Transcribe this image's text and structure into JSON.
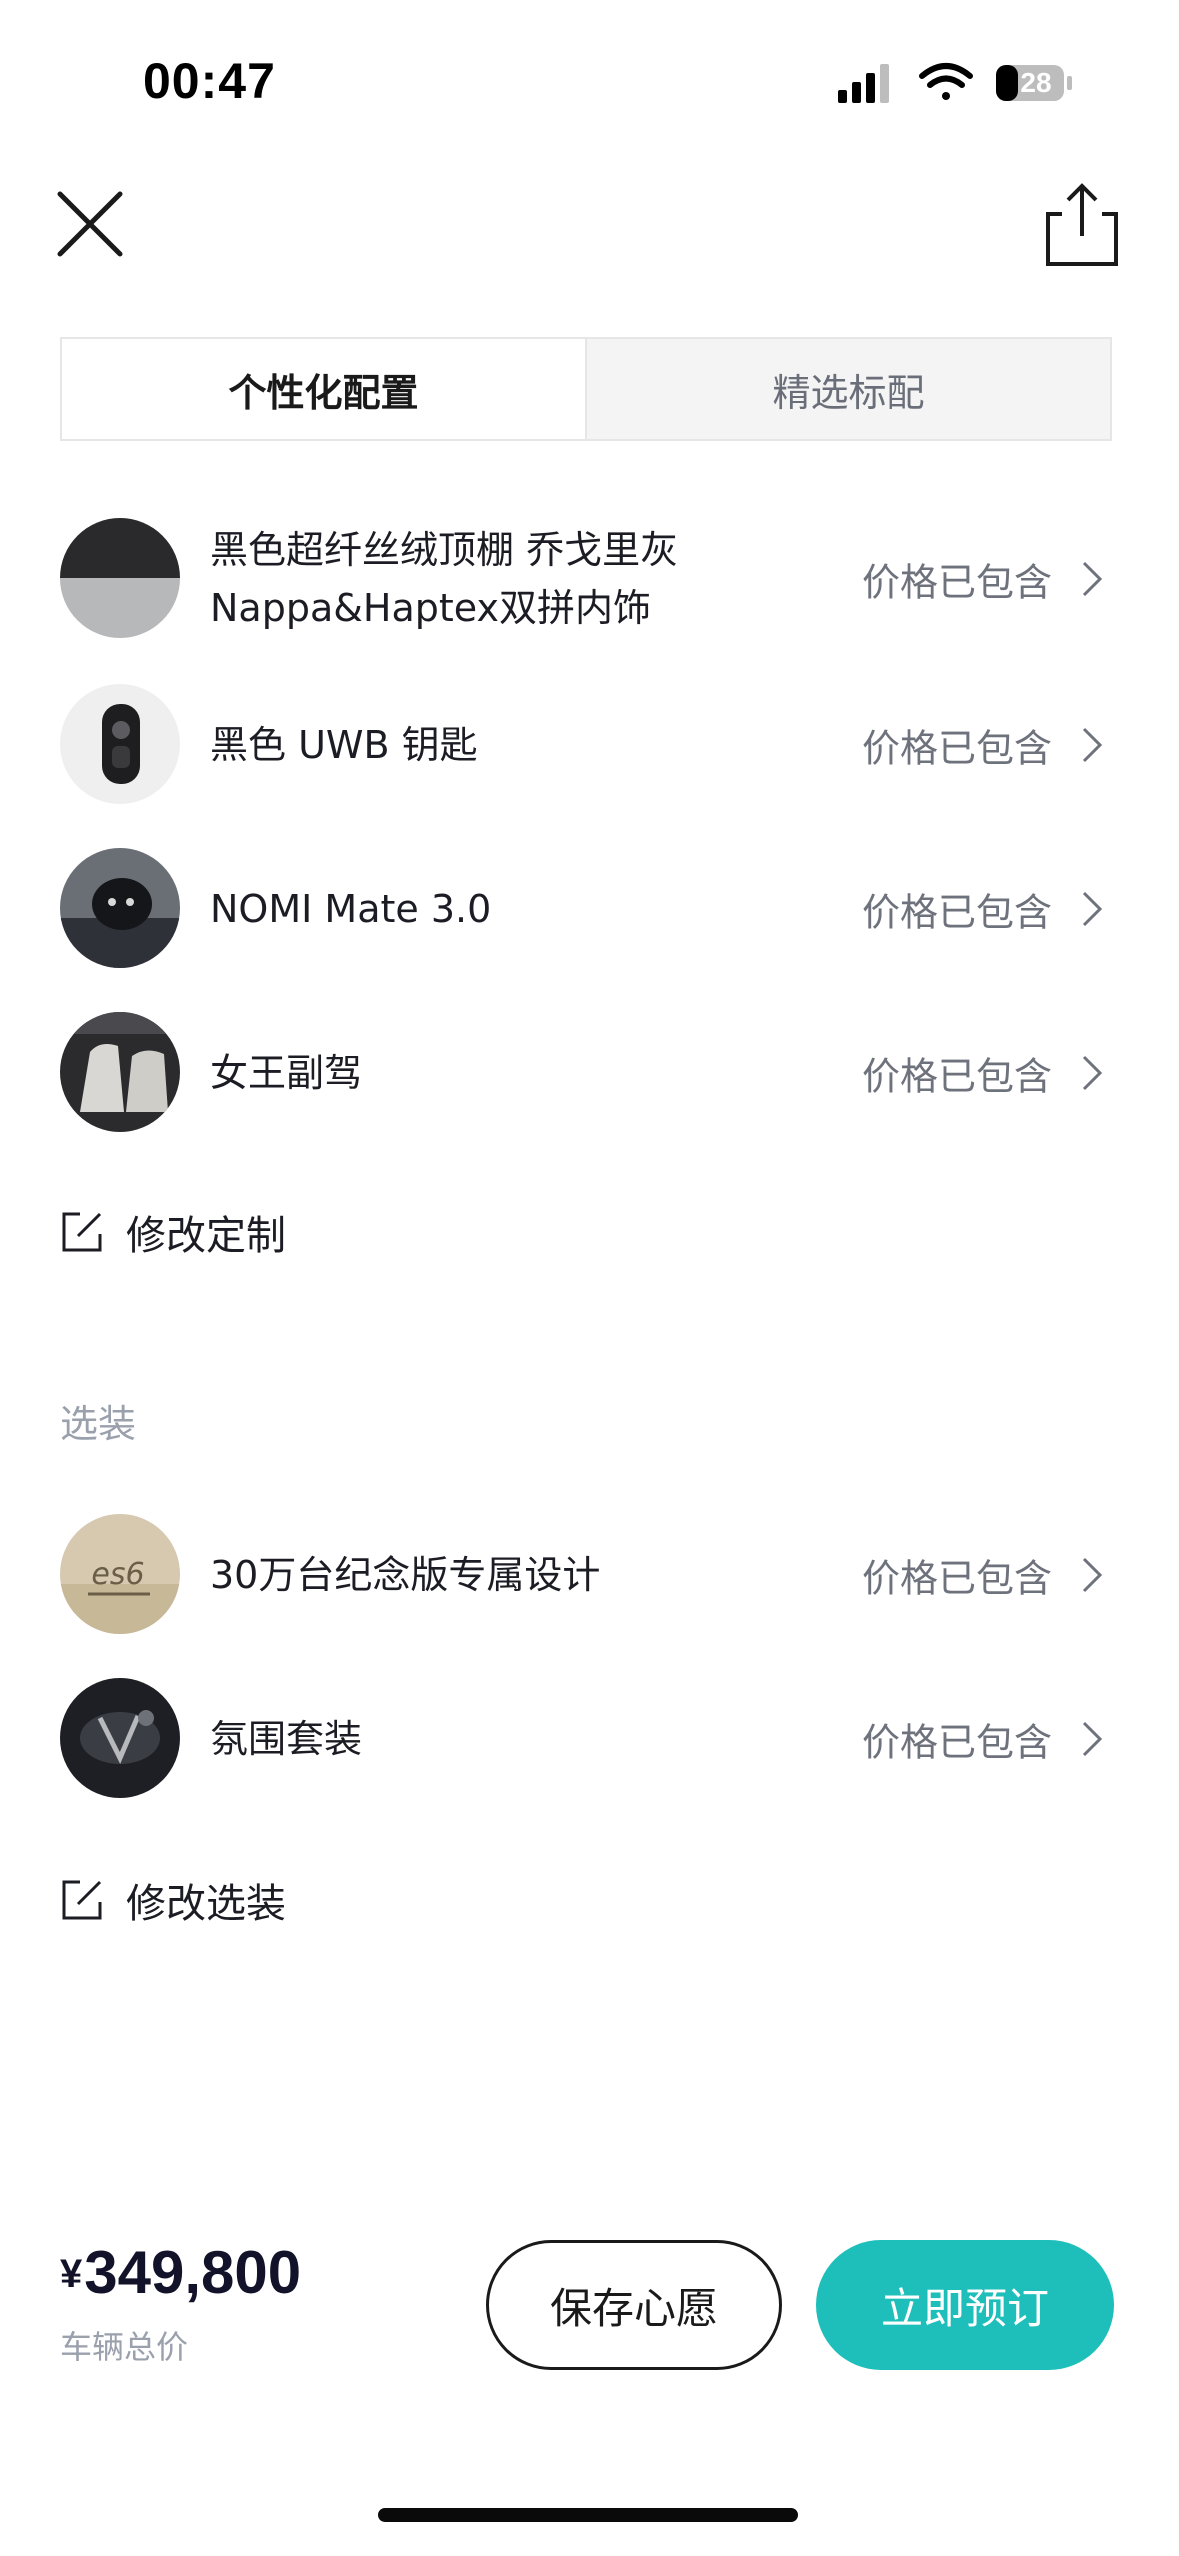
{
  "status_bar": {
    "time": "00:47",
    "battery": "28"
  },
  "header": {
    "close_icon": "close-icon",
    "share_icon": "share-icon"
  },
  "tabs": [
    {
      "label": "个性化配置",
      "active": true
    },
    {
      "label": "精选标配",
      "active": false
    }
  ],
  "config_items": [
    {
      "label_line1": "黑色超纤丝绒顶棚 乔戈里灰",
      "label_line2": "Nappa&Haptex双拼内饰",
      "price": "价格已包含"
    },
    {
      "label_line1": "黑色 UWB 钥匙",
      "label_line2": "",
      "price": "价格已包含"
    },
    {
      "label_line1": "NOMI Mate 3.0",
      "label_line2": "",
      "price": "价格已包含"
    },
    {
      "label_line1": "女王副驾",
      "label_line2": "",
      "price": "价格已包含"
    }
  ],
  "edit_custom": "修改定制",
  "options_section": {
    "title": "选装",
    "items": [
      {
        "label": "30万台纪念版专属设计",
        "price": "价格已包含",
        "badge_text": "es6"
      },
      {
        "label": "氛围套装",
        "price": "价格已包含"
      }
    ],
    "edit_label": "修改选装"
  },
  "footer": {
    "currency": "¥",
    "total_price": "349,800",
    "price_label": "车辆总价",
    "wish_button": "保存心愿",
    "order_button": "立即预订"
  },
  "colors": {
    "accent": "#1ebfba",
    "text_primary": "#1c1c24",
    "text_secondary": "#6e727c",
    "text_muted": "#9aa0ac"
  }
}
